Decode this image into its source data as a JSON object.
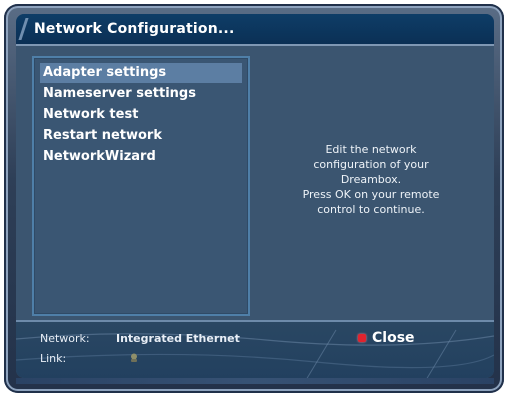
{
  "title_bar": {
    "title": "Network Configuration..."
  },
  "menu": {
    "items": [
      {
        "label": "Adapter settings",
        "selected": true
      },
      {
        "label": "Nameserver settings",
        "selected": false
      },
      {
        "label": "Network test",
        "selected": false
      },
      {
        "label": "Restart network",
        "selected": false
      },
      {
        "label": "NetworkWizard",
        "selected": false
      }
    ]
  },
  "help": {
    "lines": [
      "Edit the network",
      "configuration of your",
      "Dreambox.",
      "Press OK on your remote",
      "control to continue."
    ]
  },
  "status": {
    "network_label": "Network:",
    "network_value": "Integrated Ethernet",
    "link_label": "Link:",
    "close_label": "Close"
  },
  "icons": {
    "close_key": "red-button-icon",
    "link_state": "link-status-icon"
  },
  "colors": {
    "title_bar": "#0b3055",
    "panel_bg": "#3b5570",
    "selection": "#5c7ea3",
    "red_key": "#e0232e"
  }
}
